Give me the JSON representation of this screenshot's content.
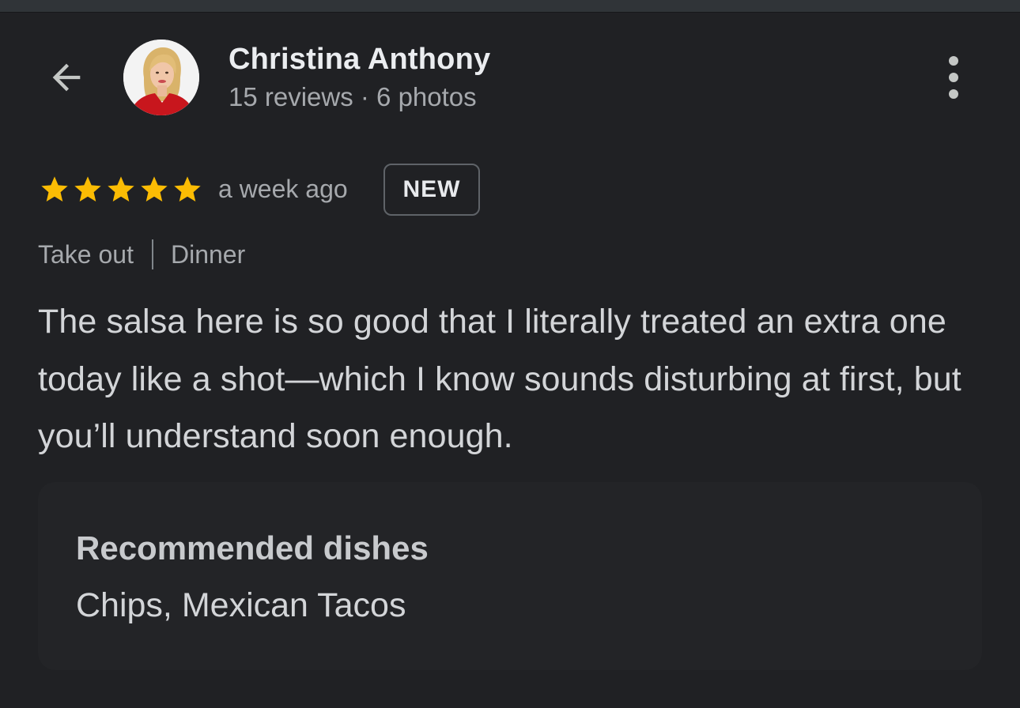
{
  "reviewer": {
    "name": "Christina Anthony",
    "stats": "15 reviews · 6 photos"
  },
  "review": {
    "rating": 5,
    "max_rating": 5,
    "time_ago": "a week ago",
    "badge": "NEW",
    "tags": [
      "Take out",
      "Dinner"
    ],
    "text": "The salsa here is so good that I literally treated an extra one today like a shot—which I know sounds disturbing at first, but you’ll understand soon enough."
  },
  "recommended": {
    "title": "Recommended dishes",
    "value": "Chips, Mexican Tacos"
  },
  "icons": {
    "back": "arrow-back-icon",
    "more": "more-vertical-icon",
    "star": "star-icon"
  },
  "colors": {
    "background": "#202124",
    "star": "#fbbc04",
    "avatar_shirt": "#c8161d"
  }
}
